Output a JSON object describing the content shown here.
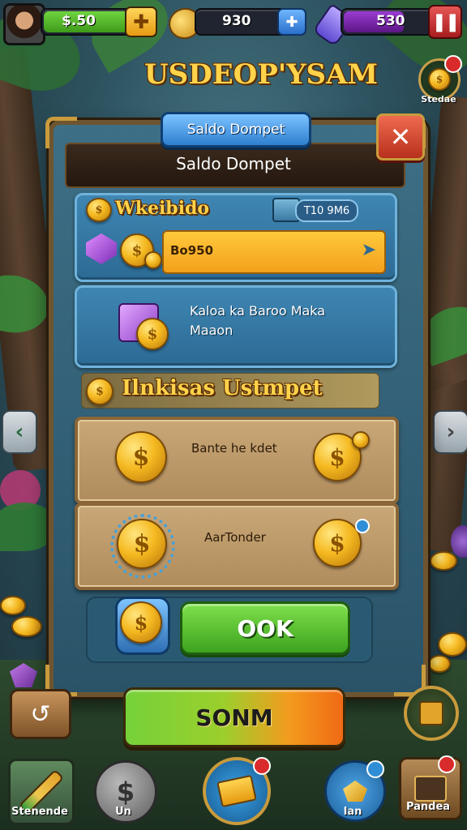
{
  "top_bar": {
    "coins_value": "$.50",
    "keys_value": "930",
    "energy_value": "530"
  },
  "game_title": "USDEOP'YSAM",
  "side_top_right_label": "Stedae",
  "panel": {
    "tab_label": "Saldo Dompet",
    "header_title": "Saldo Dompet",
    "wallet_card": {
      "title": "Wkeibido",
      "badge_value": "T10 9M6",
      "balance_value": "Bo950"
    },
    "info_card": {
      "line1": "Kaloa ka Baroo Maka",
      "line2": "Maaon"
    },
    "section_title": "Ilnkisas Ustmpet",
    "options": [
      {
        "label": "Bante he kdet"
      },
      {
        "label": "AarTonder"
      }
    ],
    "ok_label": "OOK"
  },
  "main_button_label": "SONM",
  "bottom_nav": [
    {
      "label": "Stenende",
      "icon": "sword-icon"
    },
    {
      "label": "Un",
      "icon": "coin-icon"
    },
    {
      "label": "",
      "icon": "cash-icon"
    },
    {
      "label": "Ian",
      "icon": "gem-icon"
    },
    {
      "label": "Pandea",
      "icon": "wallet-icon"
    }
  ],
  "colors": {
    "accent_gold": "#ffd34a",
    "panel_blue": "#3d6f86",
    "ok_green": "#3da31f",
    "close_red": "#d8442a"
  }
}
